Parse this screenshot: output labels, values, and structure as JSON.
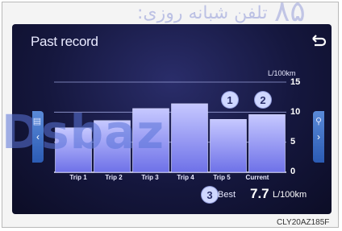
{
  "watermark": {
    "text": "تلفن شبانه روزی:",
    "big": "Dsbaz",
    "num": "۸۵"
  },
  "screen": {
    "title": "Past record",
    "unit": "L/100km",
    "markers": [
      "1",
      "2",
      "3"
    ],
    "best": {
      "label": "Best",
      "value": "7.7",
      "unit": "L/100km"
    },
    "side_left_icon": "left-arrow-icon",
    "side_right_icon": "right-arrow-icon",
    "back_icon": "back-arrow-icon",
    "colors": {
      "bar": "#8f92ff",
      "bar_top": "#c6c8ff",
      "background": "#15173e",
      "accent": "#4c79d8"
    }
  },
  "chart_data": {
    "type": "bar",
    "categories": [
      "Trip 1",
      "Trip 2",
      "Trip 3",
      "Trip 4",
      "Trip 5",
      "Current"
    ],
    "values": [
      7.4,
      8.6,
      10.6,
      11.4,
      8.8,
      9.6
    ],
    "ylabel": "L/100km",
    "yticks": [
      "15",
      "10",
      "5",
      "0"
    ],
    "ylim": [
      0,
      15
    ],
    "grid": true
  },
  "code": "CLY20AZ185F"
}
